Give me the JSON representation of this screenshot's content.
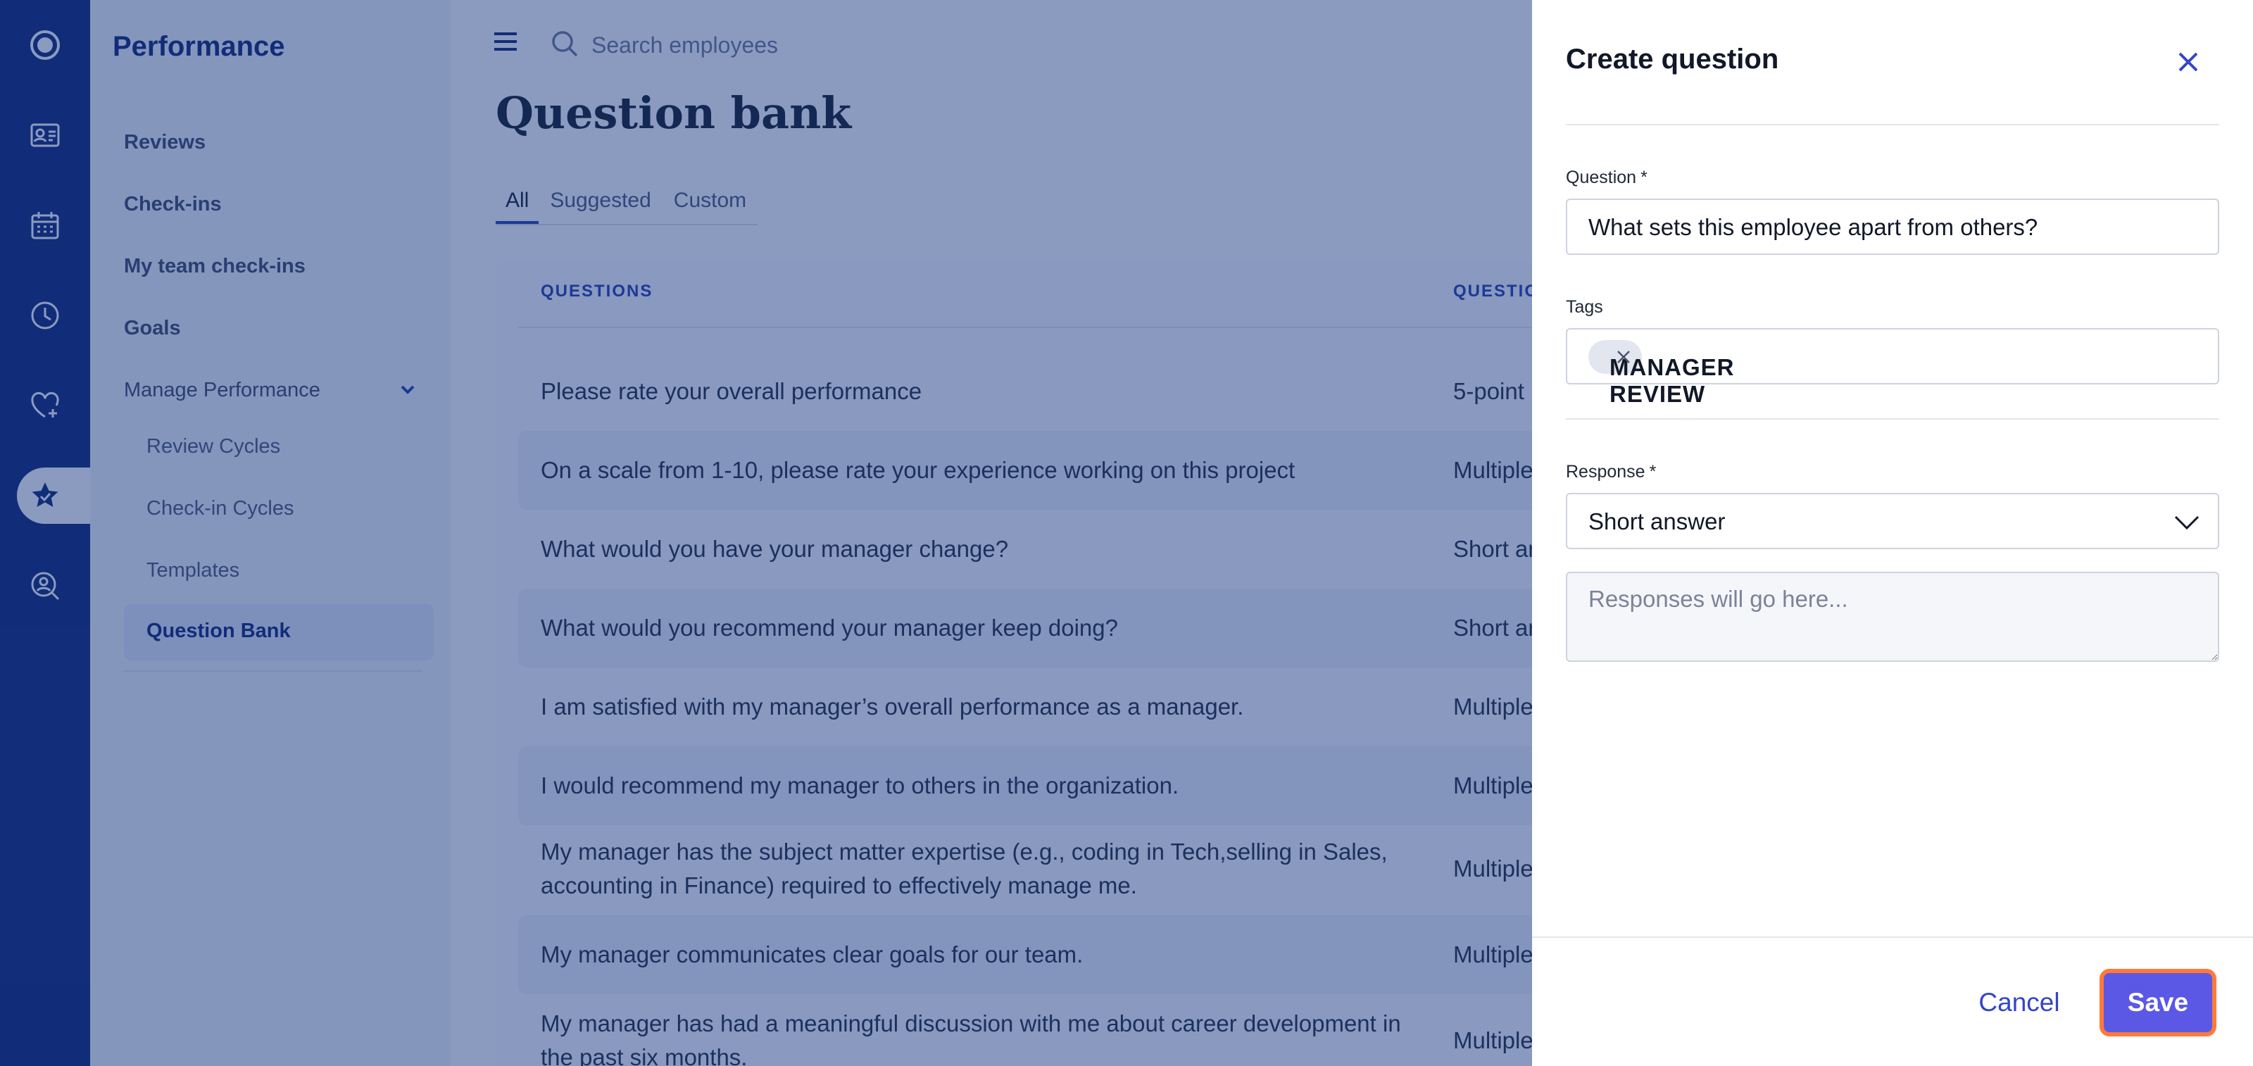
{
  "rail": {
    "items": [
      {
        "icon": "logo-ring-icon"
      },
      {
        "icon": "id-card-icon"
      },
      {
        "icon": "calendar-icon"
      },
      {
        "icon": "clock-icon"
      },
      {
        "icon": "heart-plus-icon"
      },
      {
        "icon": "star-badge-icon",
        "active": true
      },
      {
        "icon": "person-search-icon"
      }
    ]
  },
  "sidebar": {
    "title": "Performance",
    "items": [
      {
        "label": "Reviews"
      },
      {
        "label": "Check-ins"
      },
      {
        "label": "My team check-ins"
      },
      {
        "label": "Goals"
      },
      {
        "label": "Manage Performance",
        "expanded": true
      }
    ],
    "subitems": [
      {
        "label": "Review Cycles"
      },
      {
        "label": "Check-in Cycles"
      },
      {
        "label": "Templates"
      },
      {
        "label": "Question Bank",
        "active": true
      }
    ]
  },
  "search": {
    "placeholder": "Search employees"
  },
  "page": {
    "title": "Question bank"
  },
  "tabs": [
    {
      "label": "All",
      "active": true
    },
    {
      "label": "Suggested"
    },
    {
      "label": "Custom"
    }
  ],
  "table": {
    "headers": {
      "questions": "QUESTIONS",
      "type": "QUESTIO"
    },
    "rows": [
      {
        "question": "Please rate your overall performance",
        "type": "5-point"
      },
      {
        "question": "On a scale from 1-10, please rate your experience working on this project",
        "type": "Multiple"
      },
      {
        "question": "What would you have your manager change?",
        "type": "Short ar"
      },
      {
        "question": "What would you recommend your manager keep doing?",
        "type": "Short ar"
      },
      {
        "question": "I am satisfied with my manager’s overall performance as a manager.",
        "type": "Multiple"
      },
      {
        "question": "I would recommend my manager to others in the organization.",
        "type": "Multiple"
      },
      {
        "question": "My manager has the subject matter expertise (e.g., coding in Tech,selling in Sales, accounting in Finance) required to effectively manage me.",
        "type": "Multiple"
      },
      {
        "question": "My manager communicates clear goals for our team.",
        "type": "Multiple"
      },
      {
        "question": "My manager has had a meaningful discussion with me about career development in the past six months.",
        "type": "Multiple"
      }
    ]
  },
  "drawer": {
    "title": "Create question",
    "question_label": "Question",
    "question_value": "What sets this employee apart from others?",
    "tags_label": "Tags",
    "tag": "MANAGER REVIEW",
    "response_label": "Response",
    "response_value": "Short answer",
    "required_mark": "*",
    "responses_placeholder": "Responses will go here...",
    "cancel_label": "Cancel",
    "save_label": "Save"
  },
  "colors": {
    "rail": "#0b2270",
    "accent": "#1f3aa8",
    "save_button": "#5b58e6",
    "focus_ring": "#ff7a3a",
    "overlay": "rgba(24,56,130,0.5)"
  }
}
